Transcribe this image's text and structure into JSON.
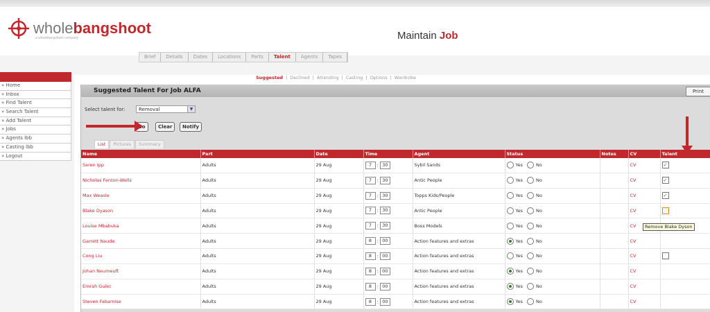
{
  "brand": {
    "logo_light": "whole",
    "logo_bold": "bangshoot",
    "tagline": "a wholebangshoot company"
  },
  "page": {
    "title_prefix": "Maintain",
    "title_bold": "Job"
  },
  "tabs": [
    {
      "label": "Brief",
      "active": false
    },
    {
      "label": "Details",
      "active": false
    },
    {
      "label": "Dates",
      "active": false
    },
    {
      "label": "Locations",
      "active": false
    },
    {
      "label": "Parts",
      "active": false
    },
    {
      "label": "Talent",
      "active": true
    },
    {
      "label": "Agents",
      "active": false
    },
    {
      "label": "Tapes",
      "active": false
    }
  ],
  "sidebar": {
    "items": [
      {
        "label": "» Home"
      },
      {
        "label": "» Inbox"
      },
      {
        "label": "» Find Talent"
      },
      {
        "label": "» Search Talent"
      },
      {
        "label": "» Add Talent"
      },
      {
        "label": "» Jobs"
      },
      {
        "label": "» Agents lbb"
      },
      {
        "label": "» Casting lbb"
      },
      {
        "label": "» Logout"
      }
    ]
  },
  "subtabs": [
    "Suggested",
    "Declined",
    "Attending",
    "Casting",
    "Options",
    "Wardrobe"
  ],
  "panel": {
    "title": "Suggested Talent For Job ALFA",
    "print_label": "Print",
    "select_label": "Select talent for:",
    "select_value": "Removal",
    "go_label": "Go",
    "clear_label": "Clear",
    "notify_label": "Notify",
    "view_tabs": [
      "List",
      "Pictures",
      "Summary"
    ]
  },
  "table": {
    "columns": [
      "Name",
      "Part",
      "Date",
      "Time",
      "Agent",
      "Status",
      "Notes",
      "CV",
      "Talent"
    ],
    "yes_label": "Yes",
    "no_label": "No",
    "rows": [
      {
        "name": "Seren Ipp",
        "part": "Adults",
        "date": "29 Aug",
        "hour": "7",
        "minute": "30",
        "agent": "Sybil Sands",
        "status": "none",
        "cv": "CV",
        "talent": "checked"
      },
      {
        "name": "Nicholas Fenton-Wells",
        "part": "Adults",
        "date": "29 Aug",
        "hour": "7",
        "minute": "30",
        "agent": "Antic People",
        "status": "none",
        "cv": "CV",
        "talent": "checked"
      },
      {
        "name": "Max Weasle",
        "part": "Adults",
        "date": "29 Aug",
        "hour": "7",
        "minute": "30",
        "agent": "Topps Kids/People",
        "status": "none",
        "cv": "CV",
        "talent": "checked"
      },
      {
        "name": "Blake Dyason",
        "part": "Adults",
        "date": "29 Aug",
        "hour": "7",
        "minute": "30",
        "agent": "Antic People",
        "status": "none",
        "cv": "CV",
        "talent": "warn"
      },
      {
        "name": "Louise Mbabuka",
        "part": "Adults",
        "date": "29 Aug",
        "hour": "7",
        "minute": "30",
        "agent": "Boss Models",
        "status": "none",
        "cv": "CV",
        "talent": "none"
      },
      {
        "name": "Garrett Naude",
        "part": "Adults",
        "date": "29 Aug",
        "hour": "8",
        "minute": "00",
        "agent": "Action features and extras",
        "status": "yes",
        "cv": "CV",
        "talent": "none"
      },
      {
        "name": "Cong Liu",
        "part": "Adults",
        "date": "29 Aug",
        "hour": "8",
        "minute": "00",
        "agent": "Action features and extras",
        "status": "none",
        "cv": "CV",
        "talent": "empty"
      },
      {
        "name": "Johan Neumeuft",
        "part": "Adults",
        "date": "29 Aug",
        "hour": "8",
        "minute": "00",
        "agent": "Action features and extras",
        "status": "yes",
        "cv": "CV",
        "talent": "none"
      },
      {
        "name": "Emrah Gulec",
        "part": "Adults",
        "date": "29 Aug",
        "hour": "8",
        "minute": "00",
        "agent": "Action features and extras",
        "status": "yes",
        "cv": "CV",
        "talent": "none"
      },
      {
        "name": "Steven Fabarnise",
        "part": "Adults",
        "date": "29 Aug",
        "hour": "8",
        "minute": "00",
        "agent": "Action features and extras",
        "status": "yes",
        "cv": "CV",
        "talent": "none"
      }
    ]
  },
  "tooltip": "Remove Blake Dyson",
  "colors": {
    "accent": "#c0282d",
    "panel": "#dcdcdc",
    "status_on": "#3a7a2a"
  }
}
